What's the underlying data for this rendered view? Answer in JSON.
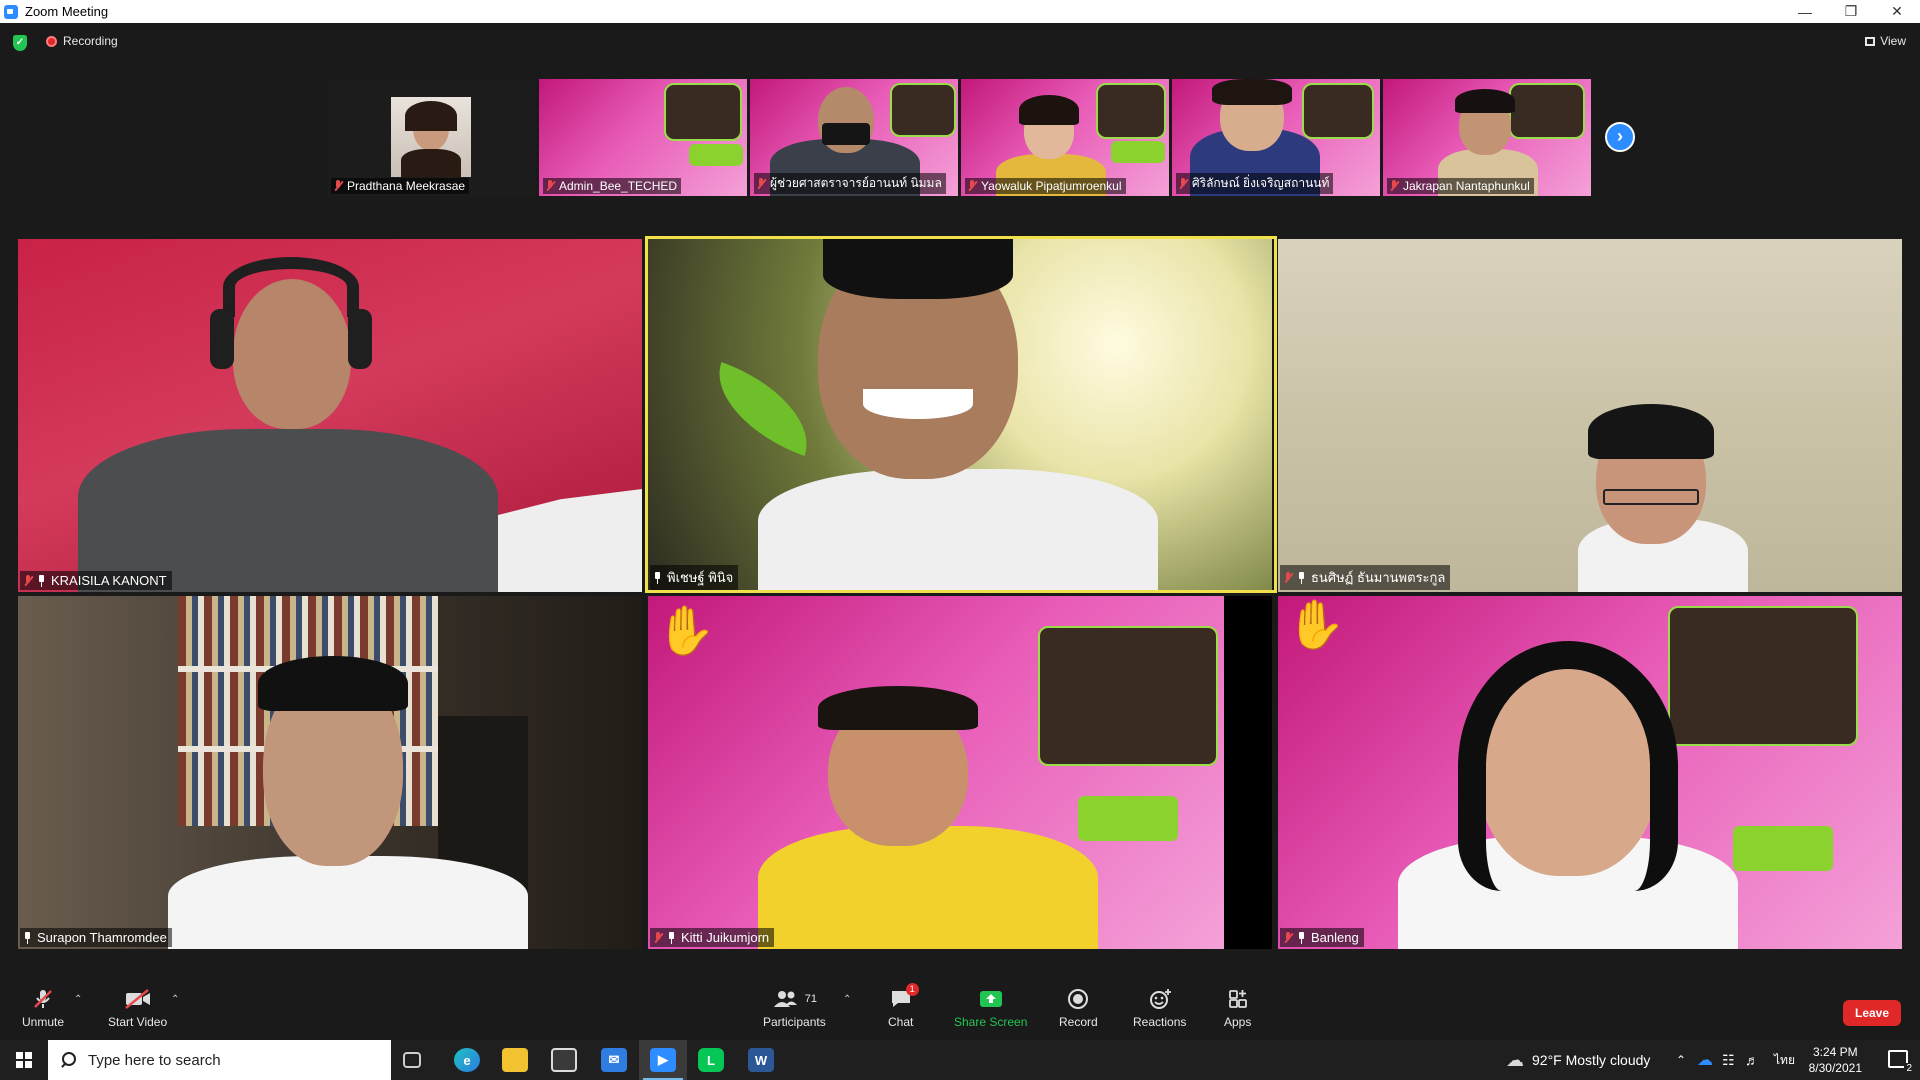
{
  "window": {
    "title": "Zoom Meeting"
  },
  "meeting": {
    "recording_label": "Recording",
    "view_label": "View"
  },
  "thumbnails": [
    {
      "name": "Pradthana Meekrasae"
    },
    {
      "name": "Admin_Bee_TECHED"
    },
    {
      "name": "ผู้ช่วยศาสตราจารย์อานนท์ นิมมล"
    },
    {
      "name": "Yaowaluk Pipatjumroenkul"
    },
    {
      "name": "ศิริลักษณ์ ยิ่งเจริญสถานนท์"
    },
    {
      "name": "Jakrapan Nantaphunkul"
    }
  ],
  "tiles": [
    {
      "name": "KRAISILA KANONT"
    },
    {
      "name": "พิเชษฐ์ พินิจ"
    },
    {
      "name": "ธนศิษฏ์ ธันมานพตระกูล"
    },
    {
      "name": "Surapon Thamromdee"
    },
    {
      "name": "Kitti Juikumjorn"
    },
    {
      "name": "Banleng"
    }
  ],
  "toolbar": {
    "unmute": "Unmute",
    "start_video": "Start Video",
    "participants": "Participants",
    "participants_count": "71",
    "chat": "Chat",
    "chat_badge": "1",
    "share_screen": "Share Screen",
    "record": "Record",
    "reactions": "Reactions",
    "apps": "Apps",
    "leave": "Leave"
  },
  "taskbar": {
    "search_placeholder": "Type here to search",
    "weather": "92°F  Mostly cloudy",
    "lang": "ไทย",
    "time": "3:24 PM",
    "date": "8/30/2021",
    "notif_count": "2"
  },
  "colors": {
    "zoom_blue": "#2d8cff",
    "active_speaker_border": "#f0e14a",
    "leave_red": "#e02828",
    "share_green": "#23c552"
  }
}
